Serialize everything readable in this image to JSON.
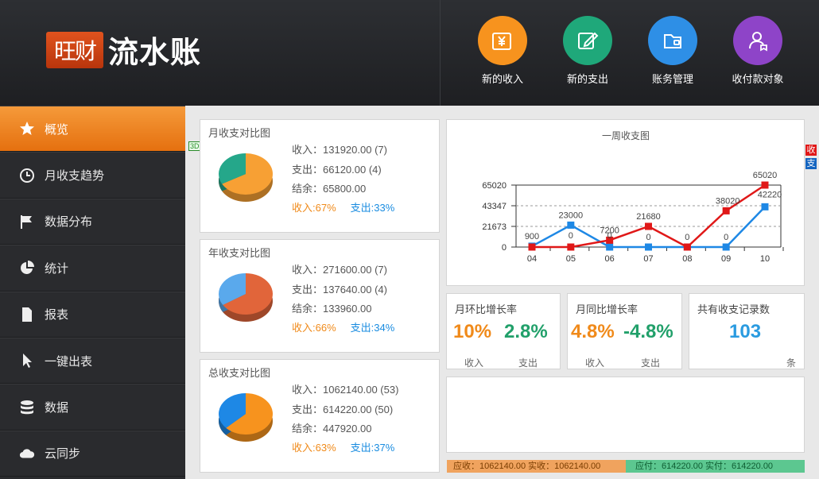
{
  "app": {
    "logo_badge": "旺财",
    "logo_text": "流水账"
  },
  "header_buttons": [
    {
      "label": "新的收入",
      "color": "#f7931e",
      "icon": "yen-icon"
    },
    {
      "label": "新的支出",
      "color": "#1fa87a",
      "icon": "pencil-icon"
    },
    {
      "label": "账务管理",
      "color": "#2e8fe6",
      "icon": "wallet-icon"
    },
    {
      "label": "收付款对象",
      "color": "#8e44c8",
      "icon": "person-icon"
    }
  ],
  "sidebar": {
    "items": [
      {
        "label": "概览",
        "icon": "star-icon",
        "active": true
      },
      {
        "label": "月收支趋势",
        "icon": "clock-icon"
      },
      {
        "label": "数据分布",
        "icon": "flag-icon"
      },
      {
        "label": "统计",
        "icon": "pie-icon"
      },
      {
        "label": "报表",
        "icon": "document-icon"
      },
      {
        "label": "一键出表",
        "icon": "cursor-icon"
      },
      {
        "label": "数据",
        "icon": "database-icon"
      },
      {
        "label": "云同步",
        "icon": "cloud-icon"
      }
    ]
  },
  "labels": {
    "income": "收入：",
    "expense": "支出：",
    "balance": "结余："
  },
  "compare_panels": [
    {
      "title": "月收支对比图",
      "income": "131920.00 (7)",
      "expense": "66120.00 (4)",
      "balance": "65800.00",
      "pct_in": "收入:67%",
      "pct_out": "支出:33%",
      "income_ratio": 0.67,
      "colors": {
        "in": "#f7a034",
        "out": "#25a78a"
      }
    },
    {
      "title": "年收支对比图",
      "income": "271600.00 (7)",
      "expense": "137640.00 (4)",
      "balance": "133960.00",
      "pct_in": "收入:66%",
      "pct_out": "支出:34%",
      "income_ratio": 0.66,
      "colors": {
        "in": "#e1653a",
        "out": "#5aa9ec"
      }
    },
    {
      "title": "总收支对比图",
      "income": "1062140.00 (53)",
      "expense": "614220.00 (50)",
      "balance": "447920.00",
      "pct_in": "收入:63%",
      "pct_out": "支出:37%",
      "income_ratio": 0.63,
      "colors": {
        "in": "#f7931e",
        "out": "#1e88e5"
      }
    }
  ],
  "badge_3d": "3D",
  "side_tags": [
    {
      "label": "收",
      "color": "#e01818"
    },
    {
      "label": "支",
      "color": "#1565c0"
    }
  ],
  "chart_data": {
    "type": "line",
    "title": "一周收支图",
    "categories": [
      "04",
      "05",
      "06",
      "07",
      "08",
      "09",
      "10"
    ],
    "yticks": [
      "65020",
      "43347",
      "21673",
      "0"
    ],
    "ylim": [
      0,
      65020
    ],
    "series": [
      {
        "name": "收",
        "color": "#e01818",
        "values": [
          0,
          0,
          7200,
          21680,
          0,
          38020,
          65020
        ],
        "labels": [
          "",
          "",
          "7200",
          "21680",
          "0",
          "38020",
          "65020"
        ]
      },
      {
        "name": "支",
        "color": "#1e88e5",
        "values": [
          900,
          23000,
          0,
          0,
          0,
          0,
          42220
        ],
        "labels": [
          "900",
          "23000",
          "",
          "0",
          "",
          "0",
          "42220"
        ]
      }
    ],
    "extra_labels": [
      "0",
      "0"
    ]
  },
  "rates": {
    "mom": {
      "title": "月环比增长率",
      "income": "10%",
      "expense": "2.8%",
      "income_label": "收入",
      "expense_label": "支出"
    },
    "yoy": {
      "title": "月同比增长率",
      "income": "4.8%",
      "expense": "-4.8%",
      "income_label": "收入",
      "expense_label": "支出"
    },
    "count": {
      "title": "共有收支记录数",
      "value": "103",
      "unit": "条"
    }
  },
  "footer": {
    "income": "应收：1062140.00 实收：1062140.00",
    "expense": "应付：614220.00 实付：614220.00"
  }
}
